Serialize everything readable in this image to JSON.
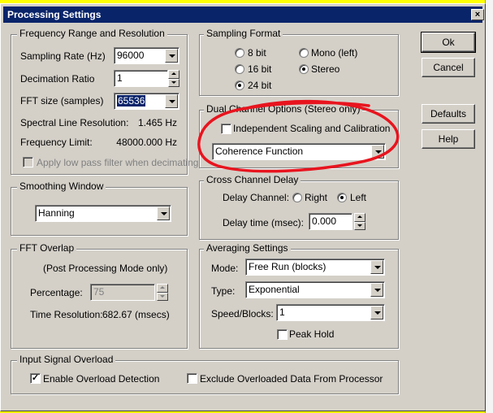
{
  "window": {
    "title": "Processing Settings",
    "close_glyph": "×"
  },
  "frequency": {
    "legend": "Frequency Range and Resolution",
    "sampling_rate_label": "Sampling Rate (Hz)",
    "sampling_rate_value": "96000",
    "decimation_label": "Decimation Ratio",
    "decimation_value": "1",
    "fft_size_label": "FFT size (samples)",
    "fft_size_value": "65536",
    "spectral_label": "Spectral Line Resolution:",
    "spectral_value": "1.465 Hz",
    "freq_limit_label": "Frequency Limit:",
    "freq_limit_value": "48000.000 Hz",
    "lowpass_label": "Apply low pass filter when decimating"
  },
  "sampling_format": {
    "legend": "Sampling Format",
    "options": {
      "bit8": "8 bit",
      "bit16": "16 bit",
      "bit24": "24 bit",
      "mono": "Mono (left)",
      "stereo": "Stereo"
    }
  },
  "dual_channel": {
    "legend": "Dual Channel Options (Stereo only)",
    "independent_label": "Independent Scaling and Calibration",
    "function_value": "Coherence Function"
  },
  "smoothing": {
    "legend": "Smoothing Window",
    "value": "Hanning"
  },
  "cross_delay": {
    "legend": "Cross Channel Delay",
    "delay_channel_label": "Delay Channel:",
    "right_label": "Right",
    "left_label": "Left",
    "delay_time_label": "Delay time (msec):",
    "delay_time_value": "0.000"
  },
  "fft_overlap": {
    "legend": "FFT Overlap",
    "note": "(Post Processing Mode only)",
    "percentage_label": "Percentage:",
    "percentage_value": "75",
    "time_res_label": "Time Resolution:",
    "time_res_value": "682.67 (msecs)"
  },
  "averaging": {
    "legend": "Averaging Settings",
    "mode_label": "Mode:",
    "mode_value": "Free Run (blocks)",
    "type_label": "Type:",
    "type_value": "Exponential",
    "speed_label": "Speed/Blocks:",
    "speed_value": "1",
    "peak_hold_label": "Peak Hold"
  },
  "overload": {
    "legend": "Input Signal Overload",
    "enable_label": "Enable Overload Detection",
    "exclude_label": "Exclude Overloaded Data From Processor",
    "check_glyph": "✓"
  },
  "buttons": {
    "ok": "Ok",
    "cancel": "Cancel",
    "defaults": "Defaults",
    "help": "Help"
  },
  "colors": {
    "annotation": "#e8141e",
    "titlebar": "#0a246a",
    "dialog_bg": "#d4d0c8",
    "background": "#ffff00"
  }
}
